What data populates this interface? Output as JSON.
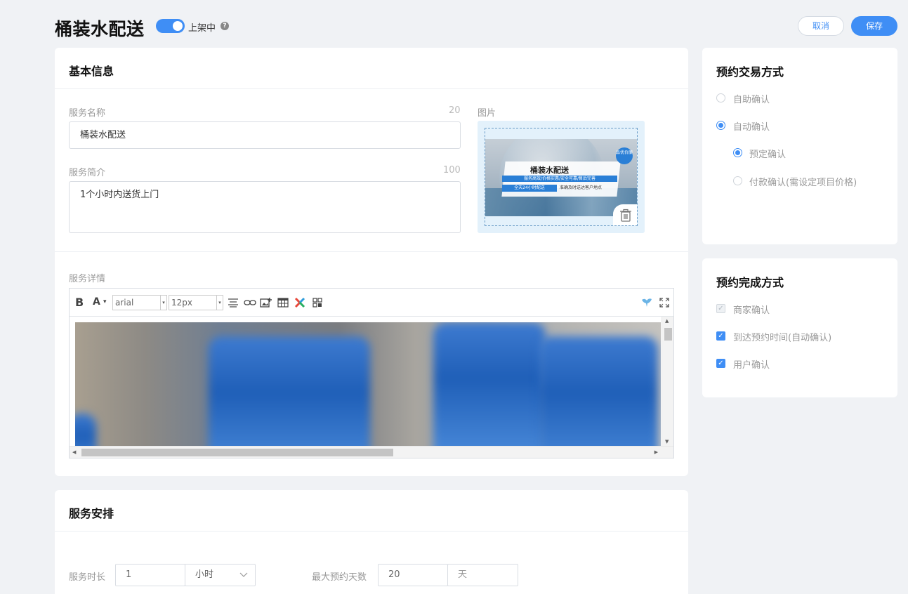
{
  "header": {
    "title": "桶装水配送",
    "status_label": "上架中",
    "help_glyph": "?",
    "cancel_label": "取消",
    "save_label": "保存"
  },
  "basic_info": {
    "title": "基本信息",
    "service_name_label": "服务名称",
    "service_name_limit": "20",
    "service_name_value": "桶装水配送",
    "intro_label": "服务简介",
    "intro_limit": "100",
    "intro_value": "1个小时内送货上门",
    "image_label": "图片",
    "image_banner": {
      "title": "桶装水配送",
      "line1": "服务高效/价格实惠/安全可靠/售后完善",
      "line2": "全天24小时配送",
      "line3": "准确及时送达客户地点",
      "badge": "品优价廉"
    },
    "detail_label": "服务详情",
    "editor": {
      "bold": "B",
      "font_color": "A",
      "font_family": "arial",
      "font_size": "12px",
      "caret": "▾"
    }
  },
  "schedule": {
    "title": "服务安排",
    "duration_label": "服务时长",
    "duration_value": "1",
    "duration_unit": "小时",
    "max_days_label": "最大预约天数",
    "max_days_value": "20",
    "max_days_unit": "天"
  },
  "trade_mode": {
    "title": "预约交易方式",
    "options": [
      {
        "label": "自助确认",
        "selected": false
      },
      {
        "label": "自动确认",
        "selected": true
      },
      {
        "label": "预定确认",
        "selected": true
      },
      {
        "label": "付款确认(需设定项目价格)",
        "selected": false
      }
    ]
  },
  "complete_mode": {
    "title": "预约完成方式",
    "check_glyph": "✓",
    "options": [
      {
        "label": "商家确认",
        "checked": true,
        "disabled": true
      },
      {
        "label": "到达预约时间(自动确认)",
        "checked": true,
        "disabled": false
      },
      {
        "label": "用户确认",
        "checked": true,
        "disabled": false
      }
    ]
  },
  "colors": {
    "accent": "#3f8ef5",
    "background": "#f0f2f5",
    "card": "#ffffff"
  }
}
